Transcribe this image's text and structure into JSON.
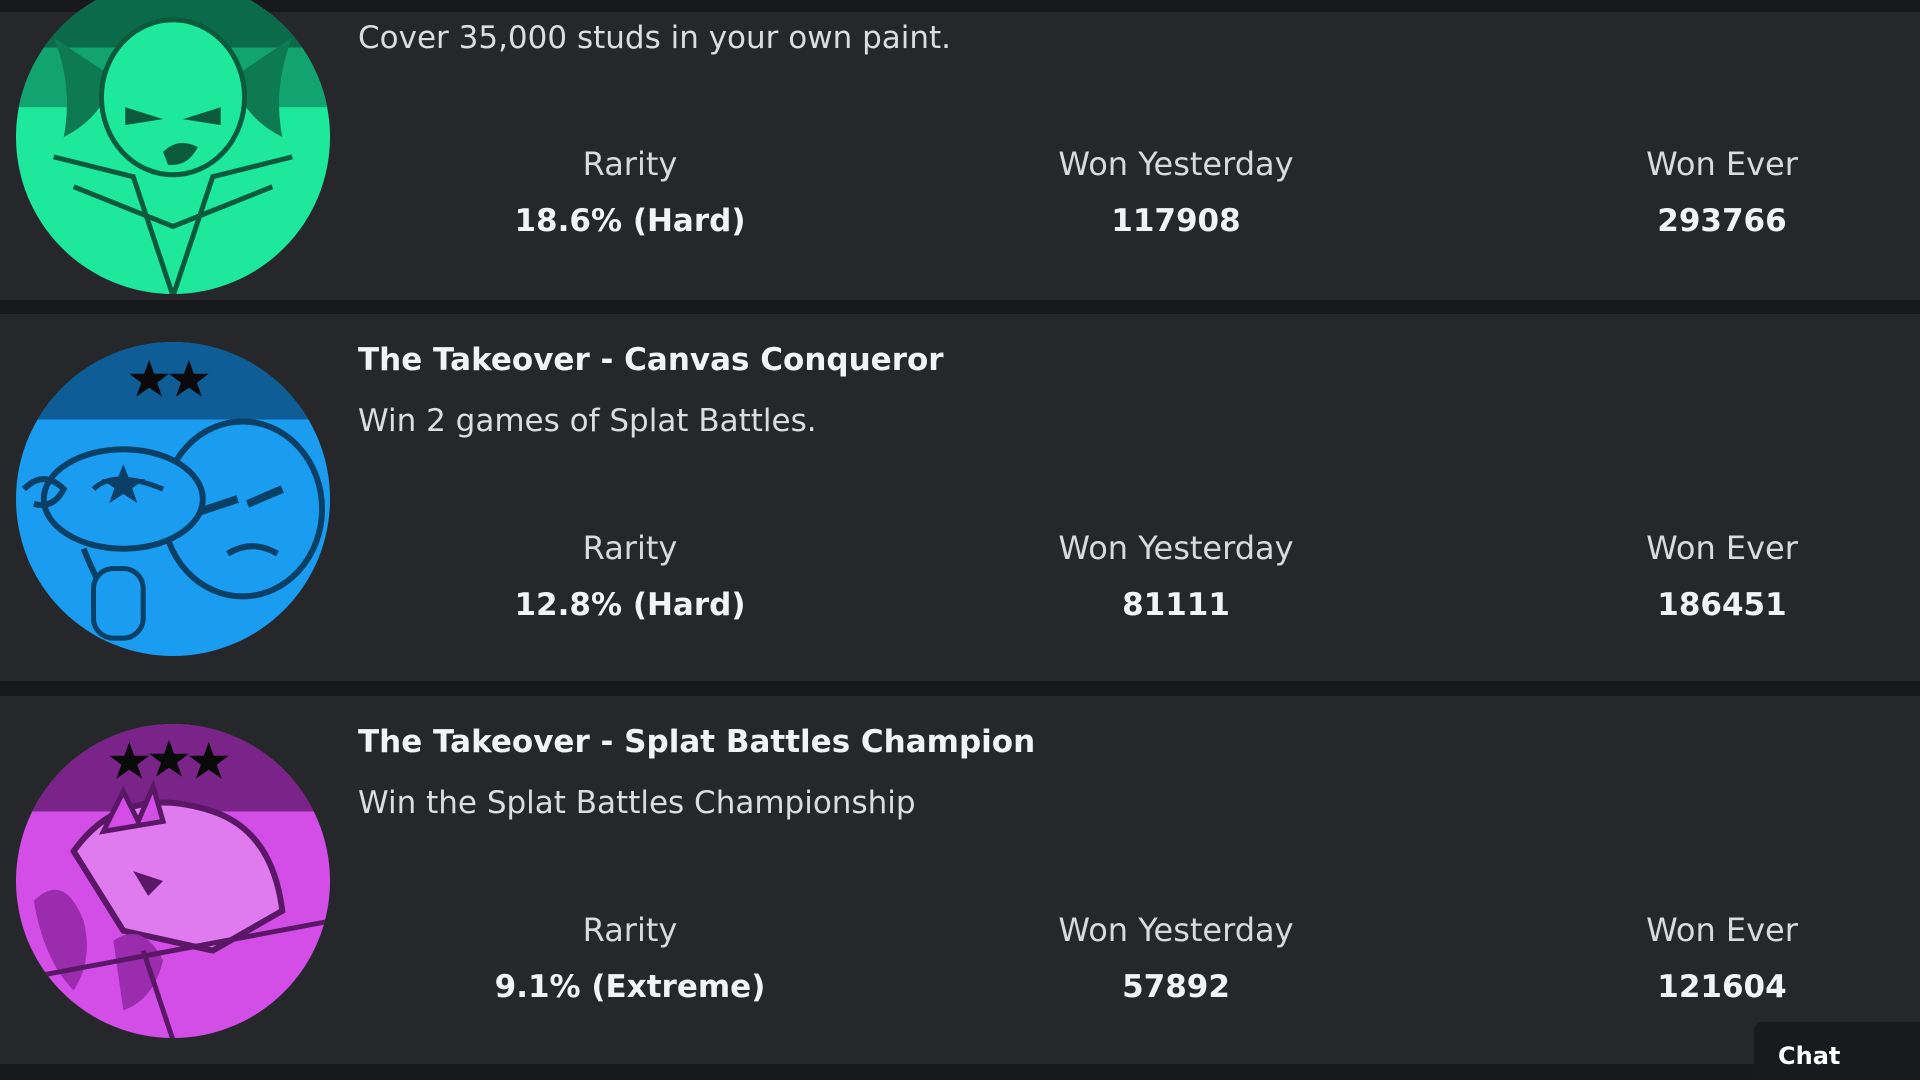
{
  "badges": [
    {
      "title": "",
      "description": "Cover 35,000 studs in your own paint.",
      "color": "#1ee89c",
      "icon": "green-face-paint-badge-icon",
      "stats": {
        "rarity_label": "Rarity",
        "rarity_value": "18.6% (Hard)",
        "won_yesterday_label": "Won Yesterday",
        "won_yesterday_value": "117908",
        "won_ever_label": "Won Ever",
        "won_ever_value": "293766"
      }
    },
    {
      "title": "The Takeover - Canvas Conqueror",
      "description": "Win 2 games of Splat Battles.",
      "color": "#1a9cf0",
      "icon": "blue-two-star-punch-badge-icon",
      "stats": {
        "rarity_label": "Rarity",
        "rarity_value": "12.8% (Hard)",
        "won_yesterday_label": "Won Yesterday",
        "won_yesterday_value": "81111",
        "won_ever_label": "Won Ever",
        "won_ever_value": "186451"
      }
    },
    {
      "title": "The Takeover - Splat Battles Champion",
      "description": "Win the Splat Battles Championship",
      "color": "#d24ee6",
      "icon": "purple-three-star-champion-badge-icon",
      "stats": {
        "rarity_label": "Rarity",
        "rarity_value": "9.1% (Extreme)",
        "won_yesterday_label": "Won Yesterday",
        "won_yesterday_value": "57892",
        "won_ever_label": "Won Ever",
        "won_ever_value": "121604"
      }
    }
  ],
  "chat": {
    "label": "Chat"
  }
}
